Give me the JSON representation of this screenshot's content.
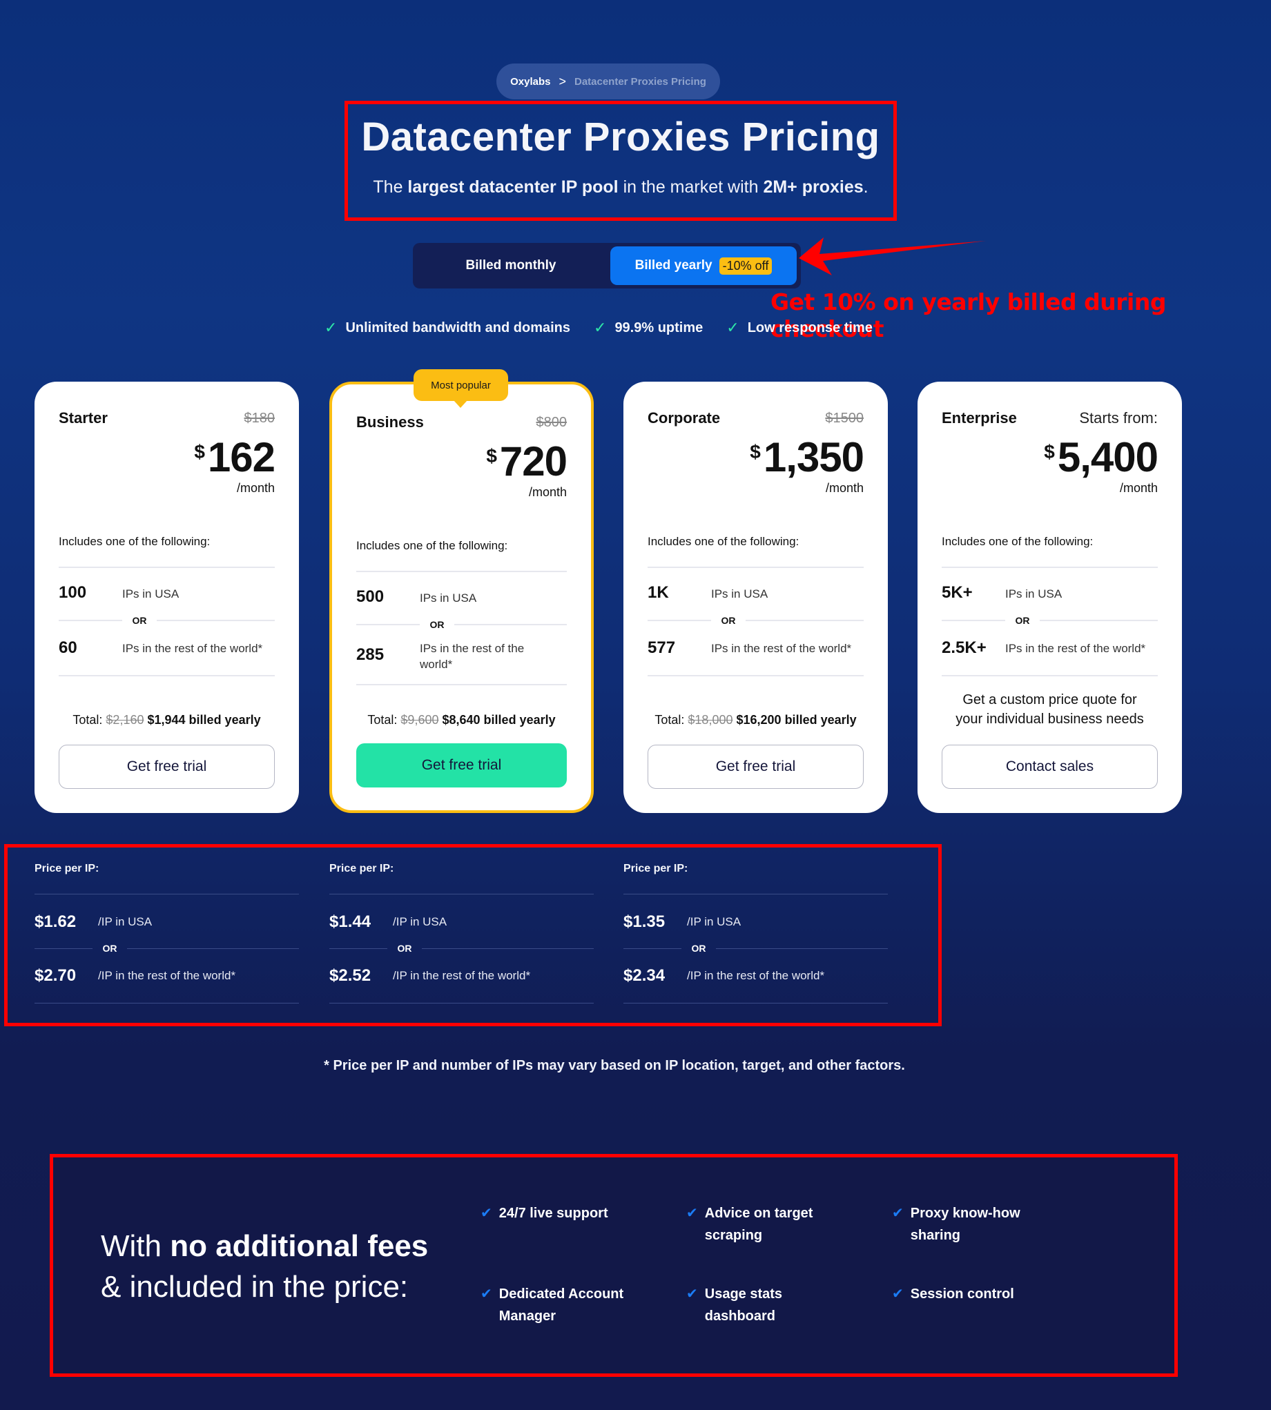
{
  "breadcrumb": {
    "home": "Oxylabs",
    "separator": ">",
    "current": "Datacenter Proxies Pricing"
  },
  "hero": {
    "title": "Datacenter Proxies Pricing",
    "subtitle_parts": [
      "The ",
      "largest datacenter IP pool",
      " in the market with ",
      "2M+ proxies",
      "."
    ]
  },
  "billing": {
    "monthly_label": "Billed monthly",
    "yearly_label": "Billed yearly",
    "yearly_badge": "-10% off",
    "selected": "yearly",
    "annotation": "Get 10% on yearly billed during checkout"
  },
  "features": [
    {
      "icon": "check-icon",
      "label": "Unlimited bandwidth and domains"
    },
    {
      "icon": "check-icon",
      "label": "99.9% uptime"
    },
    {
      "icon": "check-icon",
      "label": "Low response time"
    }
  ],
  "colors": {
    "accent_blue": "#0b74f1",
    "badge_yellow": "#fbbd13",
    "cta_green": "#23e2a6",
    "check_green": "#2ee6a8",
    "annotation_red": "#ff0000"
  },
  "plans": [
    {
      "name": "Starter",
      "old_price": "$180",
      "currency": "$",
      "price": "162",
      "period": "/month",
      "includes": "Includes one of the following:",
      "usa_count": "100",
      "usa_label": "IPs in USA",
      "or": "OR",
      "world_count": "60",
      "world_label": "IPs in the rest of the world*",
      "total_label": "Total:",
      "total_old": "$2,160",
      "total_new": "$1,944 billed yearly",
      "cta": "Get free trial"
    },
    {
      "name": "Business",
      "badge": "Most popular",
      "old_price": "$800",
      "currency": "$",
      "price": "720",
      "period": "/month",
      "includes": "Includes one of the following:",
      "usa_count": "500",
      "usa_label": "IPs in USA",
      "or": "OR",
      "world_count": "285",
      "world_label": "IPs in the rest of the world*",
      "total_label": "Total:",
      "total_old": "$9,600",
      "total_new": "$8,640 billed yearly",
      "cta": "Get free trial"
    },
    {
      "name": "Corporate",
      "old_price": "$1500",
      "currency": "$",
      "price": "1,350",
      "period": "/month",
      "includes": "Includes one of the following:",
      "usa_count": "1K",
      "usa_label": "IPs in USA",
      "or": "OR",
      "world_count": "577",
      "world_label": "IPs in the rest of the world*",
      "total_label": "Total:",
      "total_old": "$18,000",
      "total_new": "$16,200 billed yearly",
      "cta": "Get free trial"
    },
    {
      "name": "Enterprise",
      "starts_from": "Starts from:",
      "currency": "$",
      "price": "5,400",
      "period": "/month",
      "includes": "Includes one of the following:",
      "usa_count": "5K+",
      "usa_label": "IPs in USA",
      "or": "OR",
      "world_count": "2.5K+",
      "world_label": "IPs in the rest of the world*",
      "custom_quote": "Get a custom price quote for your individual business needs",
      "cta": "Contact sales"
    }
  ],
  "price_per_ip": [
    {
      "title": "Price per IP:",
      "usa_price": "$1.62",
      "usa_label": "/IP in USA",
      "or": "OR",
      "world_price": "$2.70",
      "world_label": "/IP in the rest of the world*"
    },
    {
      "title": "Price per IP:",
      "usa_price": "$1.44",
      "usa_label": "/IP in USA",
      "or": "OR",
      "world_price": "$2.52",
      "world_label": "/IP in the rest of the world*"
    },
    {
      "title": "Price per IP:",
      "usa_price": "$1.35",
      "usa_label": "/IP in USA",
      "or": "OR",
      "world_price": "$2.34",
      "world_label": "/IP in the rest of the world*"
    }
  ],
  "footnote": "* Price per IP and number of IPs may vary based on IP location, target, and other factors.",
  "included": {
    "heading_parts": [
      "With ",
      "no additional fees",
      "& included in the price:"
    ],
    "items": [
      {
        "icon": "check-icon",
        "label": "24/7 live support"
      },
      {
        "icon": "check-icon",
        "label": "Advice on target scraping"
      },
      {
        "icon": "check-icon",
        "label": "Proxy know-how sharing"
      },
      {
        "icon": "check-icon",
        "label": "Dedicated Account Manager"
      },
      {
        "icon": "check-icon",
        "label": "Usage stats dashboard"
      },
      {
        "icon": "check-icon",
        "label": "Session control"
      }
    ]
  }
}
